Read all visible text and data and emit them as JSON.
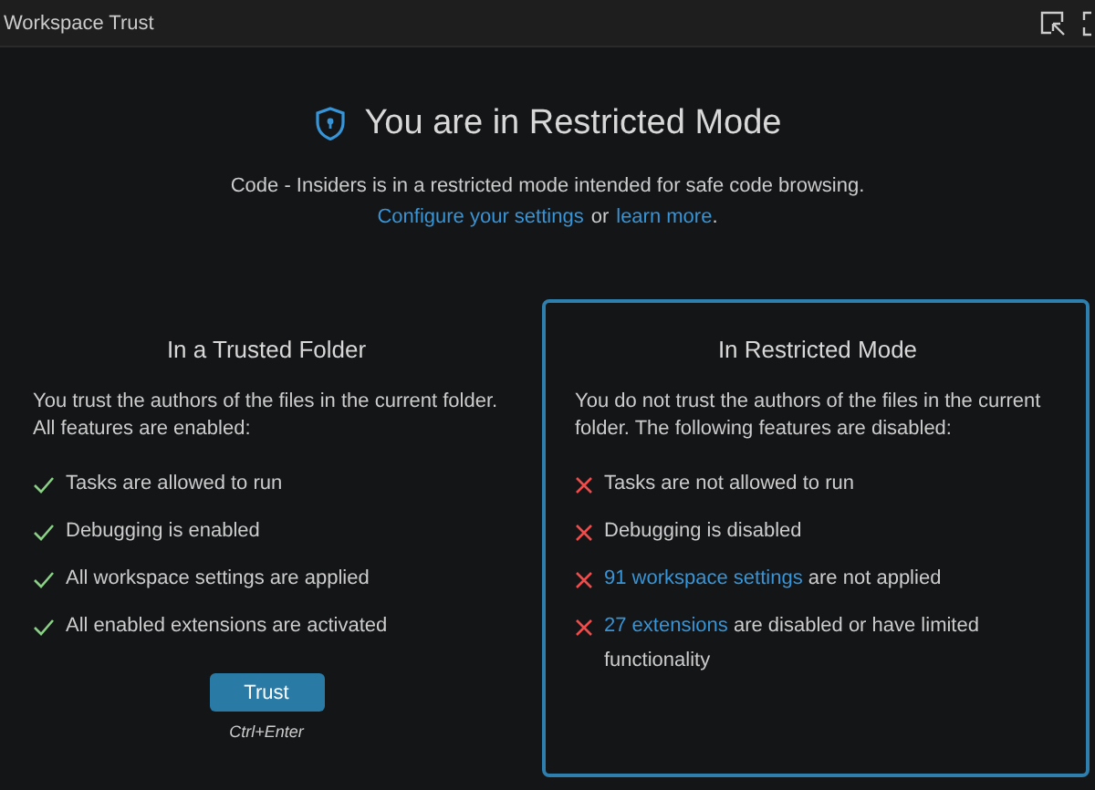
{
  "window": {
    "title": "Workspace Trust"
  },
  "header": {
    "title": "You are in Restricted Mode",
    "description": "Code - Insiders is in a restricted mode intended for safe code browsing.",
    "links": [
      {
        "text": "Configure your settings"
      },
      {
        "text": "or",
        "kind": "plain"
      },
      {
        "text": "learn more"
      },
      {
        "text": ".",
        "kind": "plain"
      }
    ]
  },
  "panels": [
    {
      "title": "In a Trusted Folder",
      "selected": false,
      "description": "You trust the authors of the files in the current folder. All features are enabled:",
      "items": [
        {
          "kind": "check",
          "text": "Tasks are allowed to run"
        },
        {
          "kind": "check",
          "text": "Debugging is enabled"
        },
        {
          "kind": "check",
          "text": "All workspace settings are applied"
        },
        {
          "kind": "check",
          "text": "All enabled extensions are activated"
        }
      ],
      "button": {
        "label": "Trust",
        "shortcut": "Ctrl+Enter"
      }
    },
    {
      "title": "In Restricted Mode",
      "selected": true,
      "description": "You do not trust the authors of the files in the current folder. The following features are disabled:",
      "items": [
        {
          "kind": "cross",
          "text": "Tasks are not allowed to run"
        },
        {
          "kind": "cross",
          "text": "Debugging is disabled"
        },
        {
          "kind": "cross",
          "link": "91 workspace settings",
          "text": "are not applied"
        },
        {
          "kind": "cross",
          "link": "27 extensions",
          "text": "are disabled or have limited functionality"
        }
      ]
    }
  ]
}
